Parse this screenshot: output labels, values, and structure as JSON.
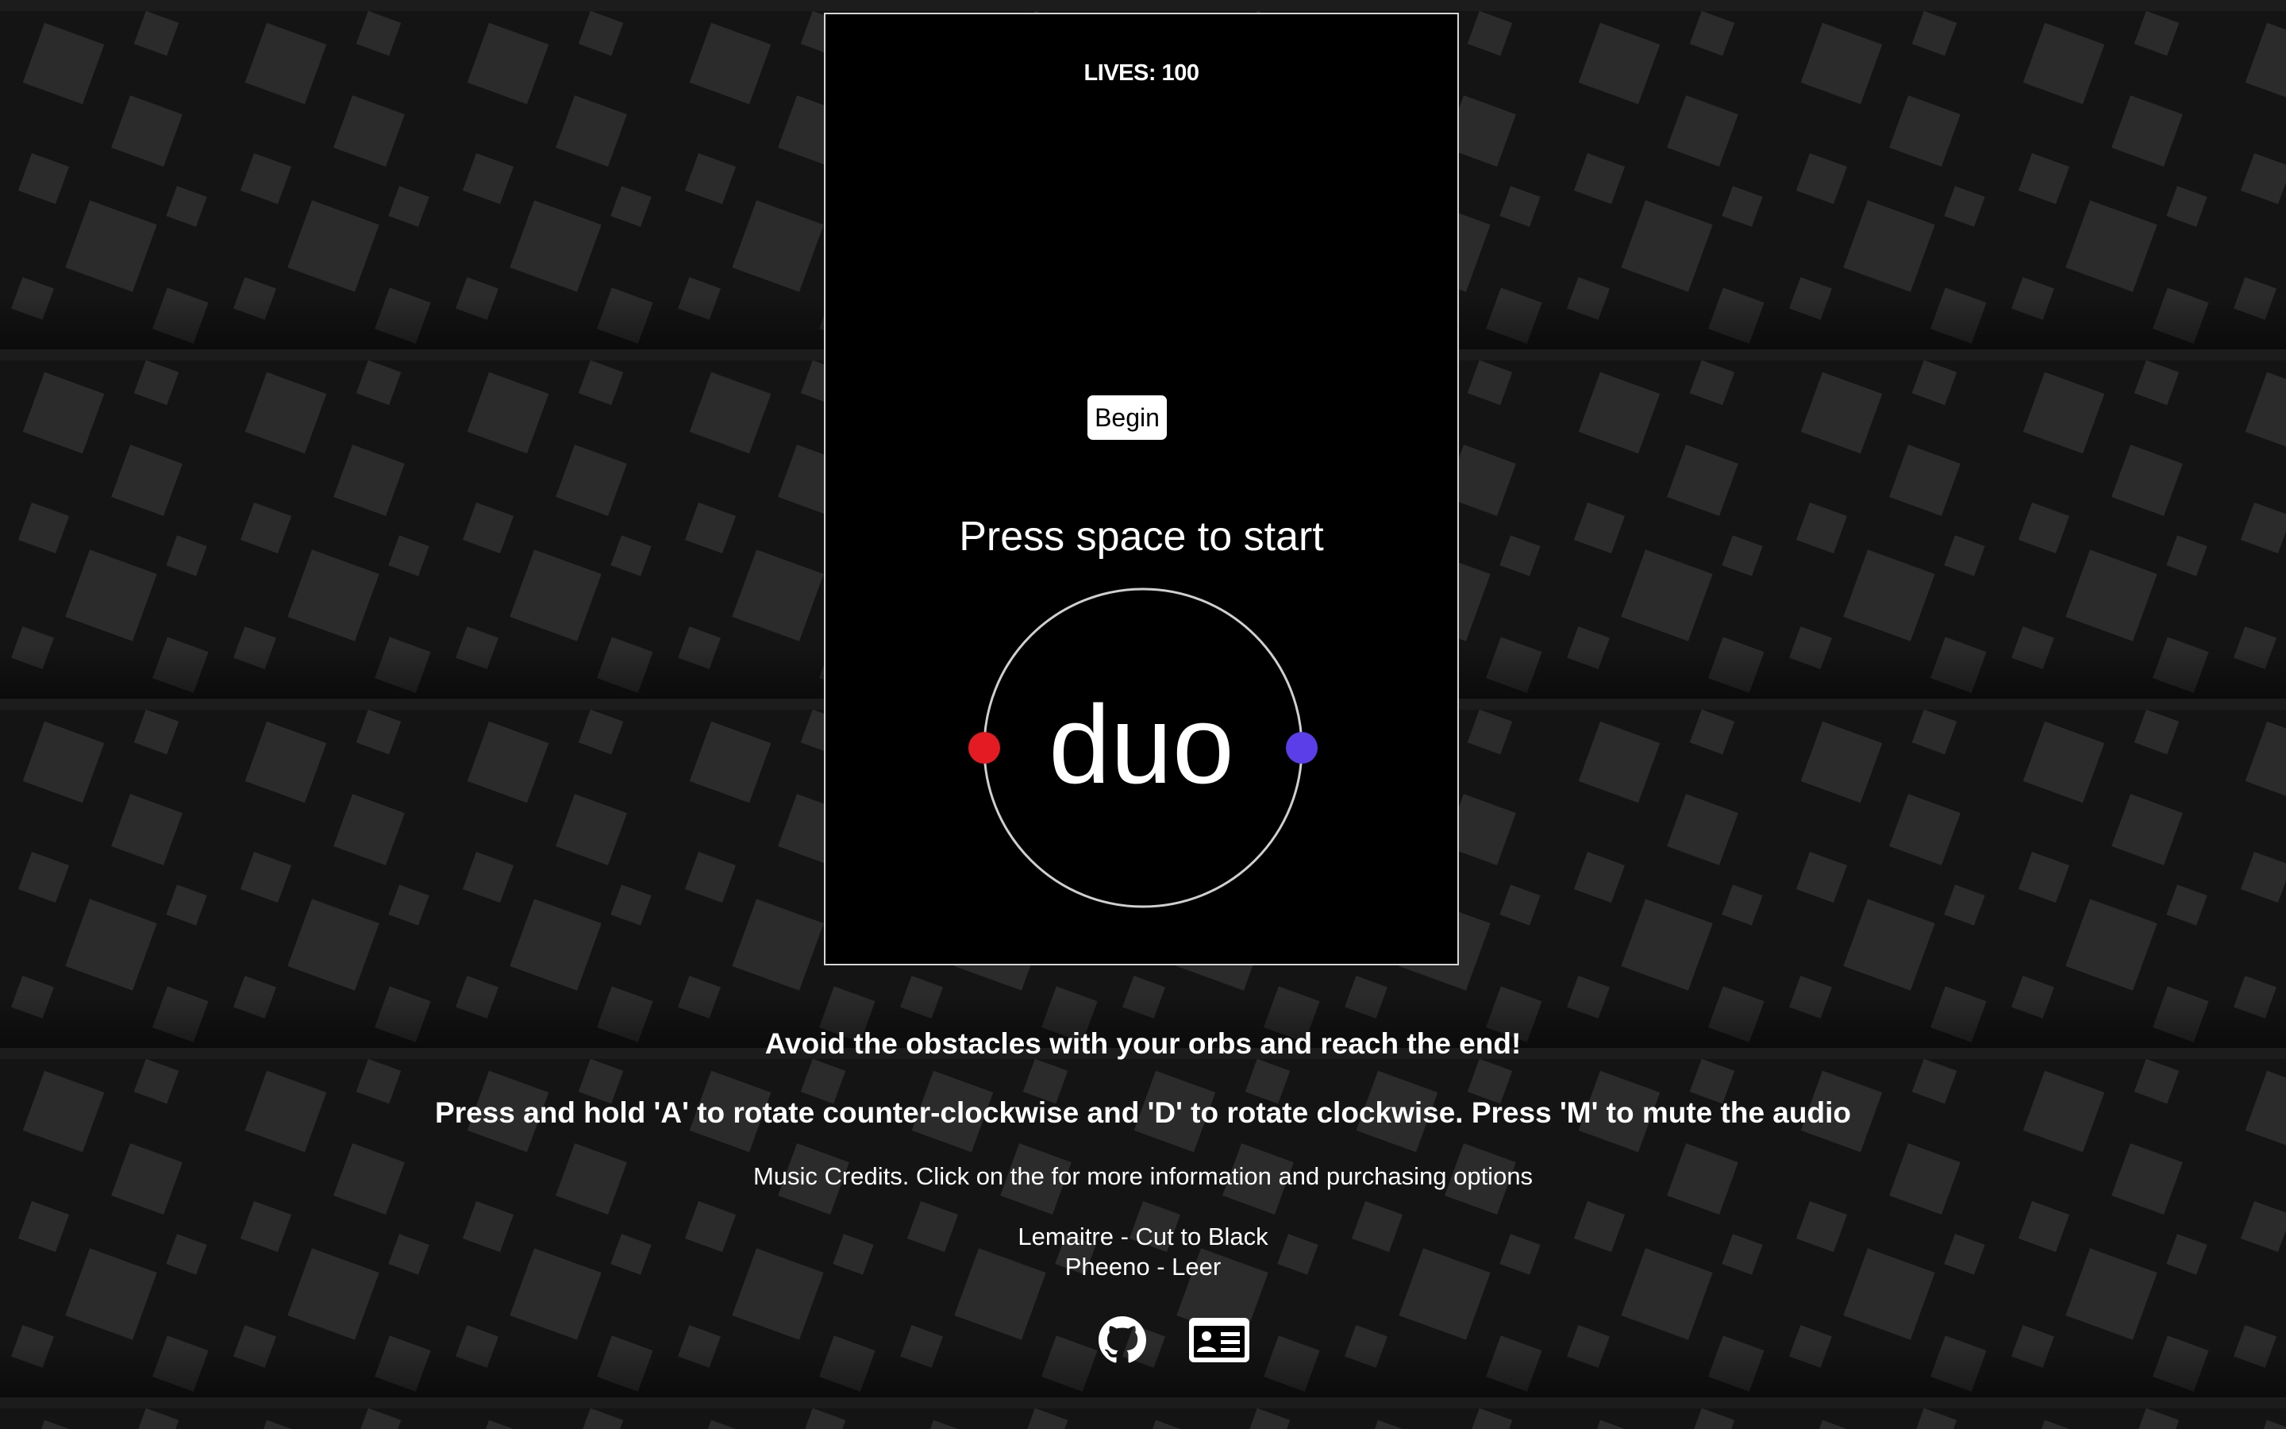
{
  "game": {
    "lives_text": "LIVES: 100",
    "begin_label": "Begin",
    "prompt": "Press space to start",
    "logo": "duo",
    "orb_left_color": "#e41b23",
    "orb_right_color": "#5b3ee8",
    "ring_color": "#cfcfcf"
  },
  "info": {
    "objective": "Avoid the obstacles with your orbs and reach the end!",
    "controls": "Press and hold 'A' to rotate counter-clockwise and 'D' to rotate clockwise. Press 'M' to mute the audio",
    "credits_heading": "Music Credits. Click on the for more information and purchasing options",
    "tracks": [
      "Lemaitre - Cut to Black",
      "Pheeno - Leer"
    ]
  },
  "footer": {
    "icons": [
      "github-icon",
      "contact-card-icon"
    ]
  },
  "theme": {
    "background": "#141414",
    "tile_color": "#2a2a2a"
  }
}
